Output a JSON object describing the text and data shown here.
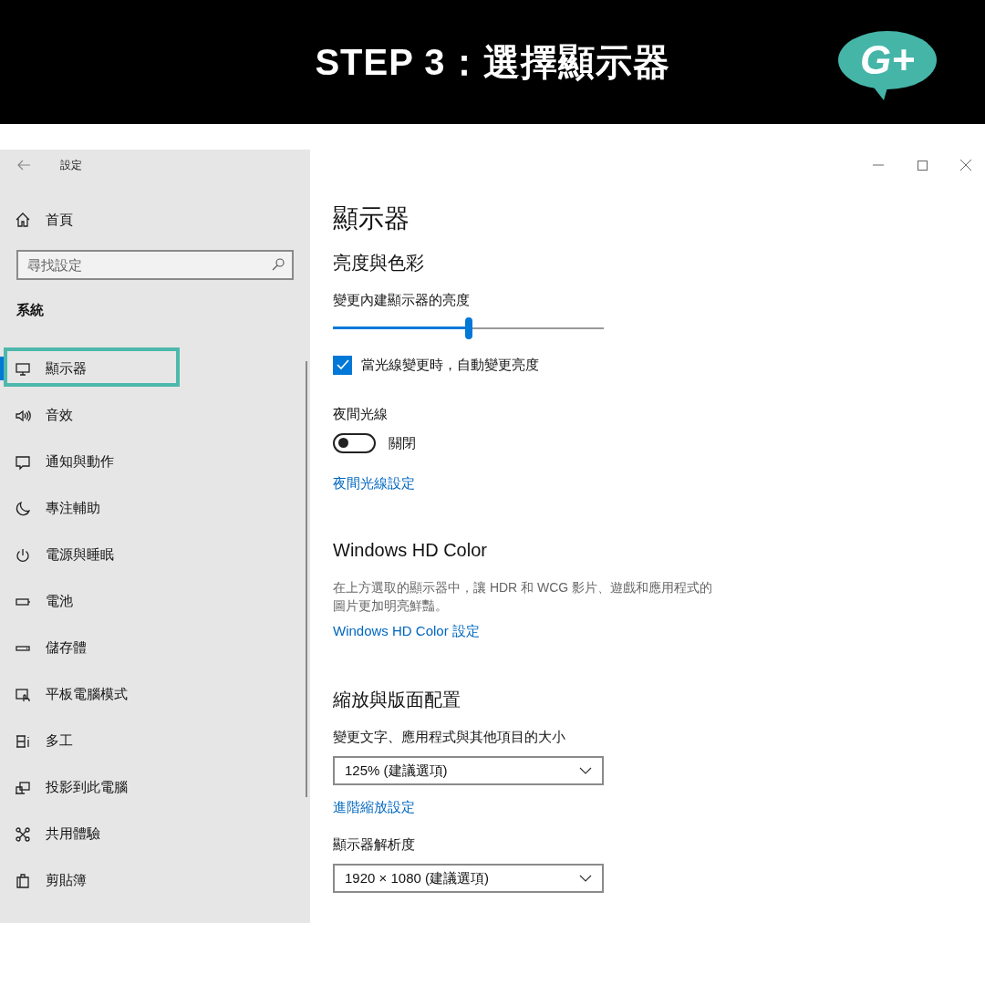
{
  "banner": {
    "title": "STEP 3：選擇顯示器",
    "logo_text": "G+"
  },
  "window": {
    "title": "設定"
  },
  "sidebar": {
    "home": "首頁",
    "search": {
      "placeholder": "尋找設定"
    },
    "section": "系統",
    "items": [
      {
        "label": "顯示器",
        "selected": true
      },
      {
        "label": "音效",
        "selected": false
      },
      {
        "label": "通知與動作",
        "selected": false
      },
      {
        "label": "專注輔助",
        "selected": false
      },
      {
        "label": "電源與睡眠",
        "selected": false
      },
      {
        "label": "電池",
        "selected": false
      },
      {
        "label": "儲存體",
        "selected": false
      },
      {
        "label": "平板電腦模式",
        "selected": false
      },
      {
        "label": "多工",
        "selected": false
      },
      {
        "label": "投影到此電腦",
        "selected": false
      },
      {
        "label": "共用體驗",
        "selected": false
      },
      {
        "label": "剪貼簿",
        "selected": false
      }
    ]
  },
  "content": {
    "title": "顯示器",
    "brightness": {
      "heading": "亮度與色彩",
      "slider_label": "變更內建顯示器的亮度",
      "level": 0.5,
      "auto": {
        "label": "當光線變更時，自動變更亮度",
        "checked": true
      },
      "night_light": {
        "label": "夜間光線",
        "on": false,
        "state_text": "關閉"
      },
      "link": "夜間光線設定"
    },
    "hd_color": {
      "heading": "Windows HD Color",
      "description": "在上方選取的顯示器中，讓 HDR 和 WCG 影片、遊戲和應用程式的圖片更加明亮鮮豔。",
      "link": "Windows HD Color 設定"
    },
    "scale": {
      "heading": "縮放與版面配置",
      "size_label": "變更文字、應用程式與其他項目的大小",
      "size_value": "125% (建議選項)",
      "link": "進階縮放設定",
      "resolution_label": "顯示器解析度",
      "resolution_value": "1920 × 1080 (建議選項)"
    }
  }
}
